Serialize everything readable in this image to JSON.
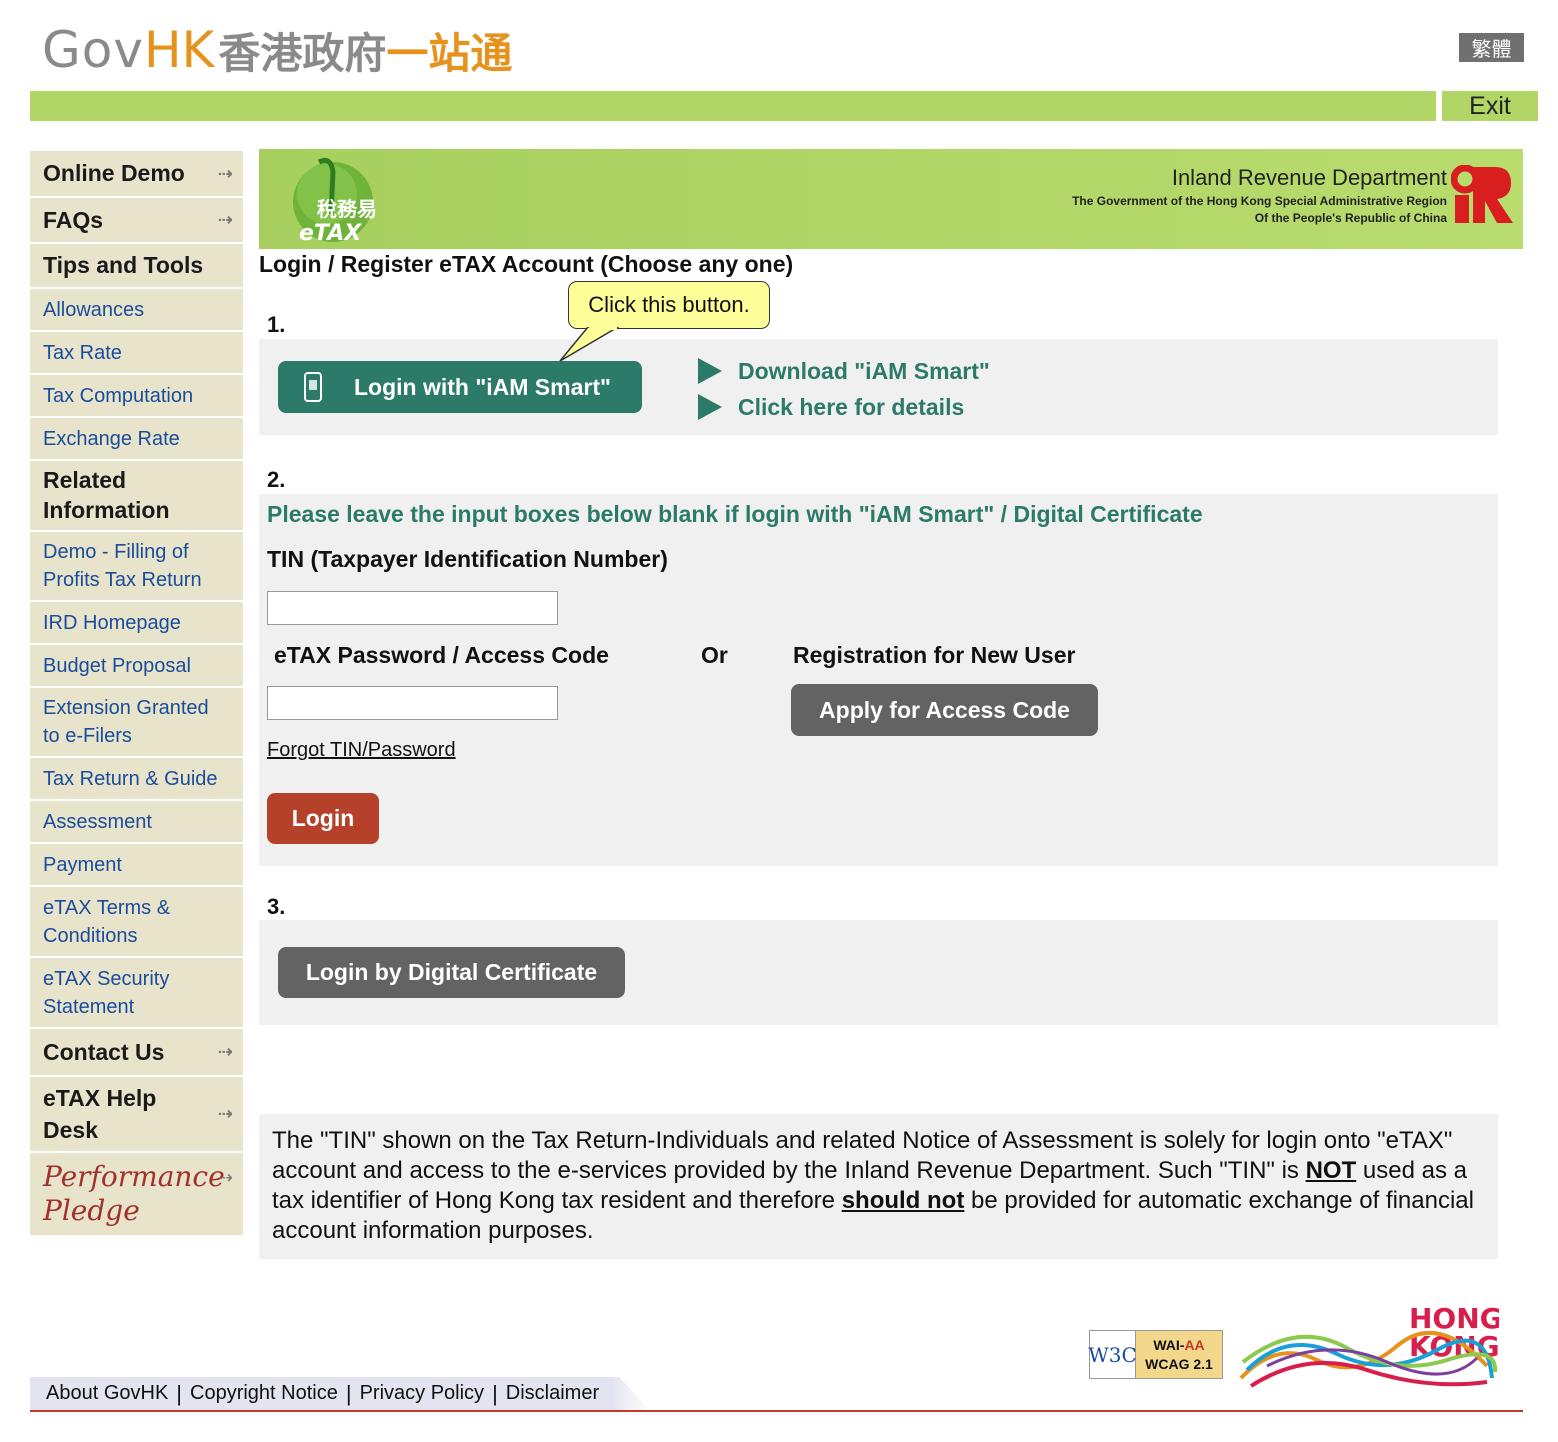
{
  "header": {
    "logo_gov": "Gov",
    "logo_hk": "HK",
    "logo_zh_gray": "香港政府",
    "logo_zh_orange": "一站通",
    "lang_button": "繁體",
    "exit_button": "Exit"
  },
  "sidebar": {
    "items": [
      {
        "label": "Online Demo",
        "type": "head",
        "arrow": true
      },
      {
        "label": "FAQs",
        "type": "head",
        "arrow": true
      },
      {
        "label": "Tips and Tools",
        "type": "head",
        "arrow": false
      },
      {
        "label": "Allowances",
        "type": "link"
      },
      {
        "label": "Tax Rate",
        "type": "link"
      },
      {
        "label": "Tax Computation",
        "type": "link"
      },
      {
        "label": "Exchange Rate",
        "type": "link"
      },
      {
        "label": "Related Information",
        "type": "head",
        "arrow": false
      },
      {
        "label": "Demo - Filling of Profits Tax Return",
        "type": "link"
      },
      {
        "label": "IRD Homepage",
        "type": "link"
      },
      {
        "label": "Budget Proposal",
        "type": "link"
      },
      {
        "label": "Extension Granted to e-Filers",
        "type": "link"
      },
      {
        "label": "Tax Return & Guide",
        "type": "link"
      },
      {
        "label": "Assessment",
        "type": "link"
      },
      {
        "label": "Payment",
        "type": "link"
      },
      {
        "label": "eTAX Terms & Conditions",
        "type": "link"
      },
      {
        "label": "eTAX Security Statement",
        "type": "link"
      },
      {
        "label": "Contact Us",
        "type": "head",
        "arrow": true
      },
      {
        "label": "eTAX Help Desk",
        "type": "head",
        "arrow": true
      }
    ],
    "performance_pledge_line1": "Performance",
    "performance_pledge_line2": "Pledge"
  },
  "banner": {
    "etax_zh": "稅務易",
    "etax_en": "eTAX",
    "dept_name": "Inland Revenue Department",
    "gov_line1": "The Government of the Hong Kong Special Administrative Region",
    "gov_line2": "Of the People's Republic of China"
  },
  "main": {
    "title": "Login / Register eTAX Account (Choose any one)",
    "step1": {
      "number": "1.",
      "callout": "Click this button.",
      "iam_button": "Login with \"iAM Smart\"",
      "links": [
        "Download \"iAM Smart\"",
        "Click here for details"
      ]
    },
    "step2": {
      "number": "2.",
      "note": "Please leave the input boxes below blank if login with \"iAM Smart\" / Digital Certificate",
      "tin_label": "TIN (Taxpayer Identification Number)",
      "tin_value": "",
      "password_label": "eTAX Password / Access Code",
      "password_value": "",
      "or_label": "Or",
      "registration_label": "Registration for New User",
      "apply_button": "Apply for Access Code",
      "forgot_link": "Forgot TIN/Password",
      "login_button": "Login"
    },
    "step3": {
      "number": "3.",
      "cert_button": "Login by Digital Certificate"
    },
    "disclaimer": {
      "part1": "The \"TIN\" shown on the Tax Return-Individuals and related Notice of Assessment is solely for login onto \"eTAX\" account and access to the e-services provided by the Inland Revenue Department. Such \"TIN\" is ",
      "em1": "NOT",
      "part2": " used as a tax identifier of Hong Kong tax resident and therefore ",
      "em2": "should not",
      "part3": " be provided for automatic exchange of financial account information purposes."
    }
  },
  "footer": {
    "links": [
      "About GovHK",
      "Copyright Notice",
      "Privacy Policy",
      "Disclaimer"
    ],
    "w3c": "W3C",
    "wai_line1_a": "WAI-",
    "wai_line1_b": "AA",
    "wai_line2": "WCAG 2.1",
    "brand_line1": "HONG",
    "brand_line2": "KONG"
  },
  "colors": {
    "green_bar": "#b2d665",
    "teal": "#2c7a68",
    "sidebar_bg": "#e8e4cc",
    "link_blue": "#1a4c9c",
    "login_red": "#b5412b",
    "gray_button": "#636363",
    "panel_bg": "#f0f0f0"
  }
}
